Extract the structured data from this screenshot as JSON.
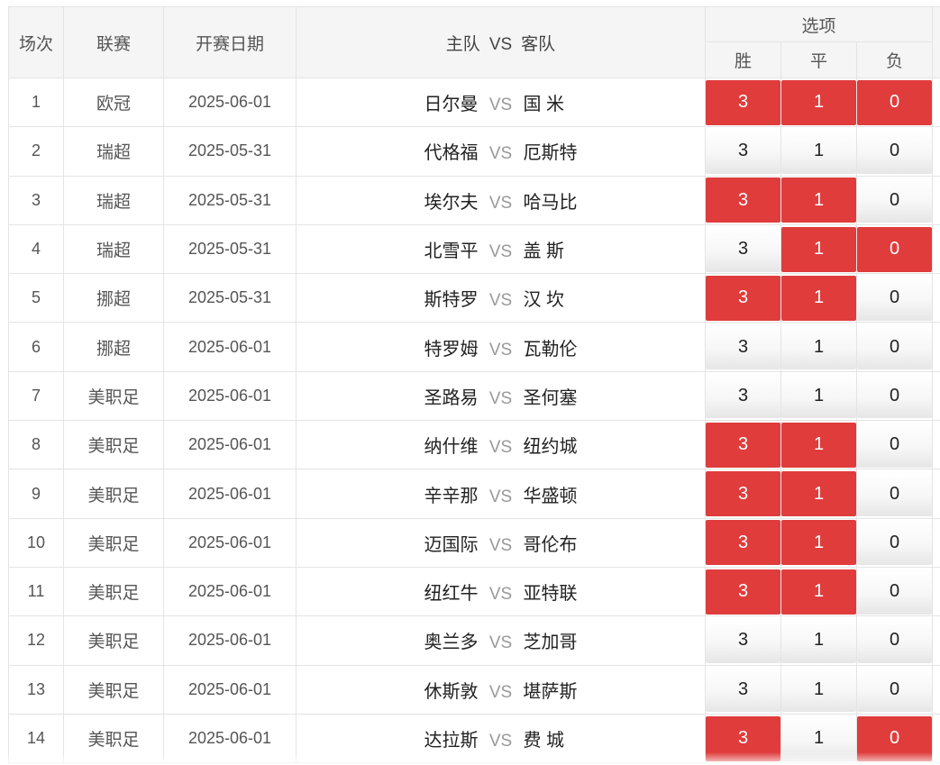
{
  "header": {
    "round": "场次",
    "league": "联赛",
    "date": "开赛日期",
    "home": "主队",
    "vs": "VS",
    "away": "客队",
    "options": "选项",
    "win": "胜",
    "draw": "平",
    "lose": "负"
  },
  "colors": {
    "selected": "#e03c3c",
    "header_bg": "#f5f5f5"
  },
  "matches": [
    {
      "no": "1",
      "league": "欧冠",
      "date": "2025-06-01",
      "home": "日尔曼",
      "vs": "VS",
      "away": "国 米",
      "opts": [
        "3",
        "1",
        "0"
      ],
      "sel": [
        true,
        true,
        true
      ]
    },
    {
      "no": "2",
      "league": "瑞超",
      "date": "2025-05-31",
      "home": "代格福",
      "vs": "VS",
      "away": "厄斯特",
      "opts": [
        "3",
        "1",
        "0"
      ],
      "sel": [
        false,
        false,
        false
      ]
    },
    {
      "no": "3",
      "league": "瑞超",
      "date": "2025-05-31",
      "home": "埃尔夫",
      "vs": "VS",
      "away": "哈马比",
      "opts": [
        "3",
        "1",
        "0"
      ],
      "sel": [
        true,
        true,
        false
      ]
    },
    {
      "no": "4",
      "league": "瑞超",
      "date": "2025-05-31",
      "home": "北雪平",
      "vs": "VS",
      "away": "盖 斯",
      "opts": [
        "3",
        "1",
        "0"
      ],
      "sel": [
        false,
        true,
        true
      ]
    },
    {
      "no": "5",
      "league": "挪超",
      "date": "2025-05-31",
      "home": "斯特罗",
      "vs": "VS",
      "away": "汉 坎",
      "opts": [
        "3",
        "1",
        "0"
      ],
      "sel": [
        true,
        true,
        false
      ]
    },
    {
      "no": "6",
      "league": "挪超",
      "date": "2025-06-01",
      "home": "特罗姆",
      "vs": "VS",
      "away": "瓦勒伦",
      "opts": [
        "3",
        "1",
        "0"
      ],
      "sel": [
        false,
        false,
        false
      ]
    },
    {
      "no": "7",
      "league": "美职足",
      "date": "2025-06-01",
      "home": "圣路易",
      "vs": "VS",
      "away": "圣何塞",
      "opts": [
        "3",
        "1",
        "0"
      ],
      "sel": [
        false,
        false,
        false
      ]
    },
    {
      "no": "8",
      "league": "美职足",
      "date": "2025-06-01",
      "home": "纳什维",
      "vs": "VS",
      "away": "纽约城",
      "opts": [
        "3",
        "1",
        "0"
      ],
      "sel": [
        true,
        true,
        false
      ]
    },
    {
      "no": "9",
      "league": "美职足",
      "date": "2025-06-01",
      "home": "辛辛那",
      "vs": "VS",
      "away": "华盛顿",
      "opts": [
        "3",
        "1",
        "0"
      ],
      "sel": [
        true,
        true,
        false
      ]
    },
    {
      "no": "10",
      "league": "美职足",
      "date": "2025-06-01",
      "home": "迈国际",
      "vs": "VS",
      "away": "哥伦布",
      "opts": [
        "3",
        "1",
        "0"
      ],
      "sel": [
        true,
        true,
        false
      ]
    },
    {
      "no": "11",
      "league": "美职足",
      "date": "2025-06-01",
      "home": "纽红牛",
      "vs": "VS",
      "away": "亚特联",
      "opts": [
        "3",
        "1",
        "0"
      ],
      "sel": [
        true,
        true,
        false
      ]
    },
    {
      "no": "12",
      "league": "美职足",
      "date": "2025-06-01",
      "home": "奥兰多",
      "vs": "VS",
      "away": "芝加哥",
      "opts": [
        "3",
        "1",
        "0"
      ],
      "sel": [
        false,
        false,
        false
      ]
    },
    {
      "no": "13",
      "league": "美职足",
      "date": "2025-06-01",
      "home": "休斯敦",
      "vs": "VS",
      "away": "堪萨斯",
      "opts": [
        "3",
        "1",
        "0"
      ],
      "sel": [
        false,
        false,
        false
      ]
    },
    {
      "no": "14",
      "league": "美职足",
      "date": "2025-06-01",
      "home": "达拉斯",
      "vs": "VS",
      "away": "费 城",
      "opts": [
        "3",
        "1",
        "0"
      ],
      "sel": [
        true,
        false,
        true
      ]
    }
  ]
}
